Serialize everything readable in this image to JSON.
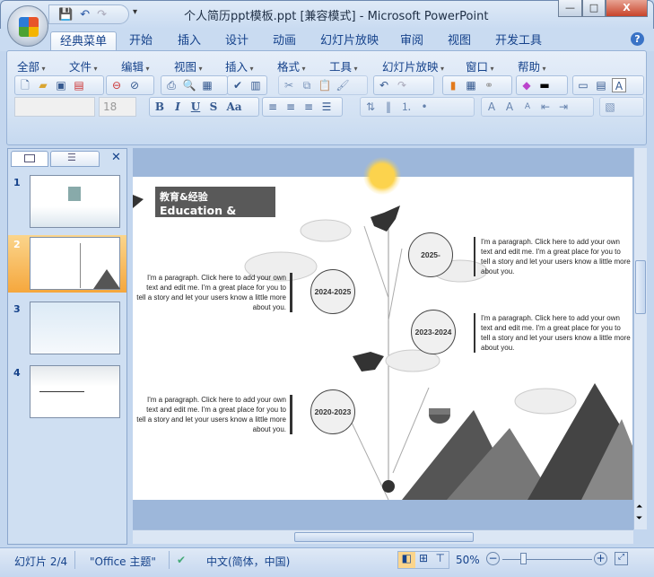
{
  "window": {
    "title": "个人简历ppt模板.ppt [兼容模式] - Microsoft PowerPoint",
    "minimize": "—",
    "maximize": "□",
    "close": "X"
  },
  "qat": {
    "save": "💾",
    "undo": "↶",
    "redo": "↷",
    "more": "▾"
  },
  "ribbon_tabs": [
    "经典菜单",
    "开始",
    "插入",
    "设计",
    "动画",
    "幻灯片放映",
    "审阅",
    "视图",
    "开发工具"
  ],
  "help": "?",
  "menus": [
    "全部",
    "文件",
    "编辑",
    "视图",
    "插入",
    "格式",
    "工具",
    "幻灯片放映",
    "窗口",
    "帮助"
  ],
  "font": {
    "name": "",
    "size": "18"
  },
  "format_buttons": [
    "B",
    "I",
    "U",
    "S",
    "Aa"
  ],
  "slides_pane": {
    "tabs": [
      "slides",
      "outline"
    ],
    "close": "✕",
    "slides": [
      {
        "num": "1"
      },
      {
        "num": "2"
      },
      {
        "num": "3"
      },
      {
        "num": "4"
      }
    ],
    "selected": 2
  },
  "slide": {
    "heading_cn": "教育&经验",
    "heading_en": "Education &",
    "entries": [
      {
        "year": "2025-",
        "text": "I'm a paragraph. Click here to add your own text and edit me. I'm a great place for you to tell a story and let your users know a little more about you."
      },
      {
        "year": "2024-2025",
        "text": "I'm a paragraph. Click here to add your own text and edit me. I'm a great place for you to tell a story and let your users know a little more about you."
      },
      {
        "year": "2023-2024",
        "text": "I'm a paragraph. Click here to add your own text and edit me. I'm a great place for you to tell a story and let your users know a little more about you."
      },
      {
        "year": "2020-2023",
        "text": "I'm a paragraph. Click here to add your own text and edit me. I'm a great place for you to tell a story and let your users know a little more about you."
      }
    ]
  },
  "status": {
    "slide": "幻灯片 2/4",
    "theme": "\"Office 主题\"",
    "language": "中文(简体，中国)",
    "zoom": "50%",
    "zoom_fraction": 0.5
  }
}
